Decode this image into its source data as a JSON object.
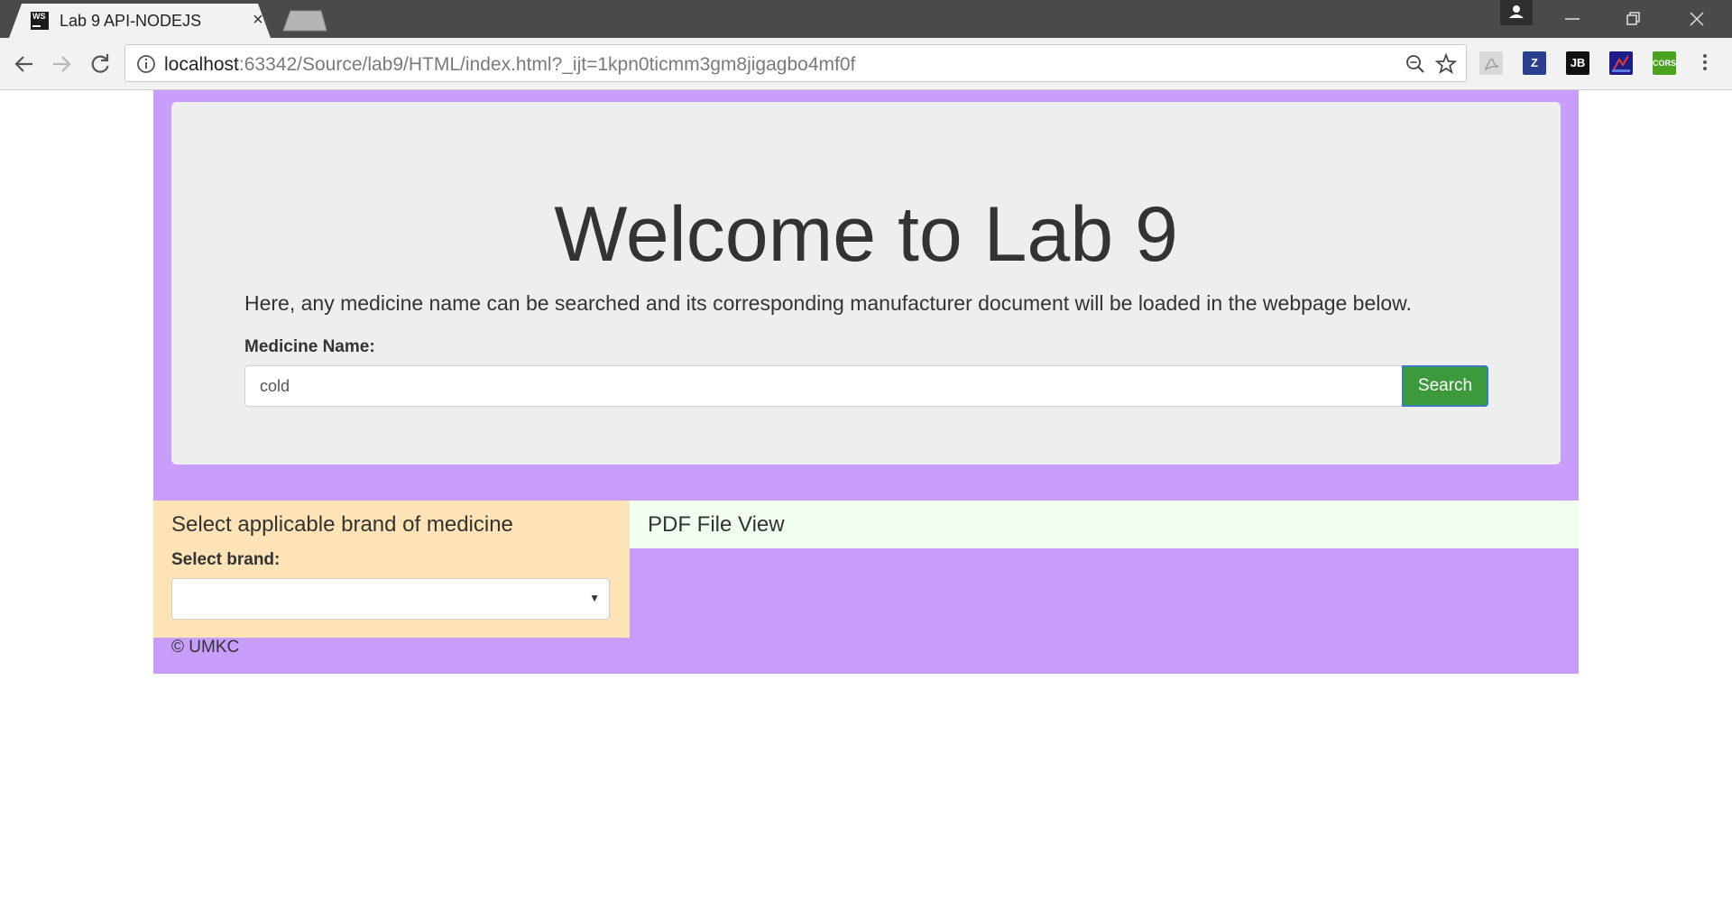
{
  "browser": {
    "tab_title": "Lab 9 API-NODEJS",
    "tab_close": "×",
    "url_host": "localhost",
    "url_rest": ":63342/Source/lab9/HTML/index.html?_ijt=1kpn0ticmm3gm8jigagbo4mf0f",
    "favicon_text": "WS",
    "extensions": [
      {
        "name": "acrobat",
        "label": "",
        "color": "#d9d9d9"
      },
      {
        "name": "zotero",
        "label": "Z",
        "color": "#2a3f8f"
      },
      {
        "name": "jetbrains",
        "label": "JB",
        "color": "#111111"
      },
      {
        "name": "ext-graph",
        "label": "",
        "color": "#1d1d8a"
      },
      {
        "name": "cors",
        "label": "CORS",
        "color": "#4aa31f"
      }
    ]
  },
  "jumbotron": {
    "title": "Welcome to Lab 9",
    "description": "Here, any medicine name can be searched and its corresponding manufacturer document will be loaded in the webpage below.",
    "medicine_label": "Medicine Name:",
    "medicine_value": "cold",
    "search_label": "Search"
  },
  "brand_panel": {
    "heading": "Select applicable brand of medicine",
    "label": "Select brand:",
    "selected": ""
  },
  "pdf_panel": {
    "heading": "PDF File View"
  },
  "footer": {
    "text": "© UMKC"
  },
  "colors": {
    "container_bg": "#c89efc",
    "jumbotron_bg": "#eeeeee",
    "brand_panel_bg": "#fde3b5",
    "pdf_panel_bg": "#f0fff0",
    "search_button": "#3c9a3c"
  }
}
